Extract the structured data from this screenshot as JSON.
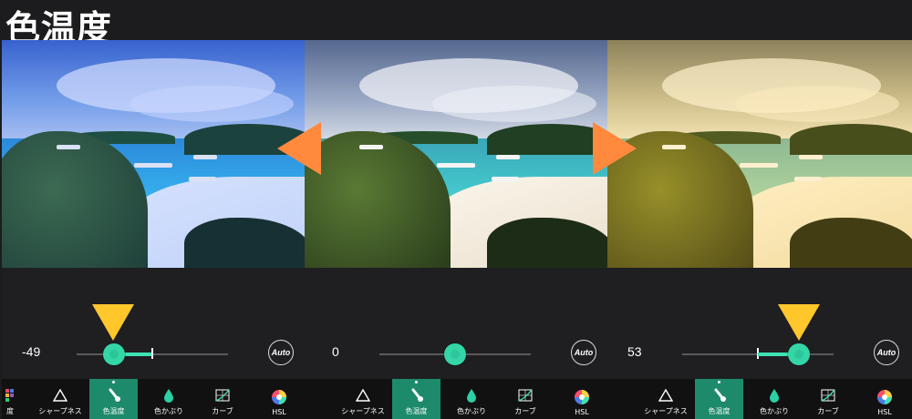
{
  "title": "色温度",
  "colors": {
    "accent": "#3fe0b4",
    "active_tab": "#1d8a6c",
    "arrow": "#ff8a3d",
    "pointer": "#ffc72c"
  },
  "panels": [
    {
      "value": "-49",
      "slider_fraction": 0.24,
      "auto_label": "Auto",
      "tools": [
        "度",
        "シャープネス",
        "色温度",
        "色かぶり",
        "カーブ",
        "HSL"
      ],
      "active_tool": "色温度",
      "tint": "cool"
    },
    {
      "value": "0",
      "slider_fraction": 0.5,
      "auto_label": "Auto",
      "tools": [
        "",
        "シャープネス",
        "色温度",
        "色かぶり",
        "カーブ",
        "HSL"
      ],
      "active_tool": "色温度",
      "tint": "neutral"
    },
    {
      "value": "53",
      "slider_fraction": 0.77,
      "auto_label": "Auto",
      "tools": [
        "",
        "シャープネス",
        "色温度",
        "色かぶり",
        "カーブ",
        "HSL"
      ],
      "active_tool": "色温度",
      "tint": "warm"
    }
  ],
  "icons": {
    "left_arrow": "arrow-left-icon",
    "right_arrow": "arrow-right-icon",
    "pointer": "pointer-triangle-icon"
  }
}
